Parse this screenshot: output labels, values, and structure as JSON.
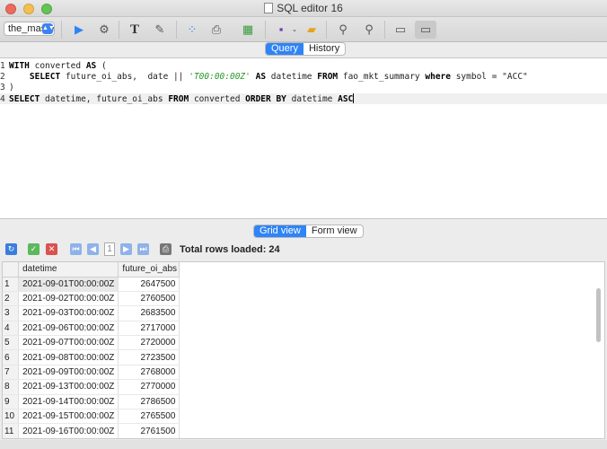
{
  "window": {
    "title": "SQL editor 16"
  },
  "toolbar": {
    "database": "the_maste"
  },
  "editor_tabs": [
    {
      "label": "Query",
      "active": true
    },
    {
      "label": "History",
      "active": false
    }
  ],
  "view_tabs": [
    {
      "label": "Grid view",
      "active": true
    },
    {
      "label": "Form view",
      "active": false
    }
  ],
  "query": {
    "line_numbers": [
      "1",
      "2",
      "3",
      "4"
    ],
    "l1_kw": "WITH",
    "l1_a": " converted ",
    "l1_kw2": "AS",
    "l1_b": " (",
    "l2_kw": "SELECT",
    "l2_a": " future_oi_abs,  date || ",
    "l2_str": "'T00:00:00Z'",
    "l2_b": " ",
    "l2_kw2": "AS",
    "l2_c": " datetime ",
    "l2_kw3": "FROM",
    "l2_d": " fao_mkt_summary ",
    "l2_kw4": "where",
    "l2_e": " symbol = \"ACC\"",
    "l3_a": ")",
    "l4_kw": "SELECT",
    "l4_a": " datetime, future_oi_abs ",
    "l4_kw2": "FROM",
    "l4_b": " converted ",
    "l4_kw3": "ORDER BY",
    "l4_c": " datetime ",
    "l4_kw4": "ASC"
  },
  "grid": {
    "page": "1",
    "rows_loaded": "Total rows loaded: 24",
    "columns": [
      "datetime",
      "future_oi_abs"
    ],
    "rows": [
      [
        "1",
        "2021-09-01T00:00:00Z",
        "2647500"
      ],
      [
        "2",
        "2021-09-02T00:00:00Z",
        "2760500"
      ],
      [
        "3",
        "2021-09-03T00:00:00Z",
        "2683500"
      ],
      [
        "4",
        "2021-09-06T00:00:00Z",
        "2717000"
      ],
      [
        "5",
        "2021-09-07T00:00:00Z",
        "2720000"
      ],
      [
        "6",
        "2021-09-08T00:00:00Z",
        "2723500"
      ],
      [
        "7",
        "2021-09-09T00:00:00Z",
        "2768000"
      ],
      [
        "8",
        "2021-09-13T00:00:00Z",
        "2770000"
      ],
      [
        "9",
        "2021-09-14T00:00:00Z",
        "2786500"
      ],
      [
        "10",
        "2021-09-15T00:00:00Z",
        "2765500"
      ],
      [
        "11",
        "2021-09-16T00:00:00Z",
        "2761500"
      ]
    ]
  },
  "colors": {
    "accent": "#2f84f6",
    "keyword_string": "#2b9a2b"
  },
  "icons": [
    "play-icon",
    "stop-icon",
    "format-text-icon",
    "comment-icon",
    "tree-icon",
    "print-icon",
    "export-icon",
    "save-icon",
    "open-folder-icon",
    "zoom-in-icon",
    "zoom-out-icon",
    "layout-single-icon",
    "layout-split-icon",
    "refresh-icon",
    "commit-icon",
    "rollback-icon",
    "first-page-icon",
    "prev-page-icon",
    "next-page-icon",
    "last-page-icon"
  ]
}
